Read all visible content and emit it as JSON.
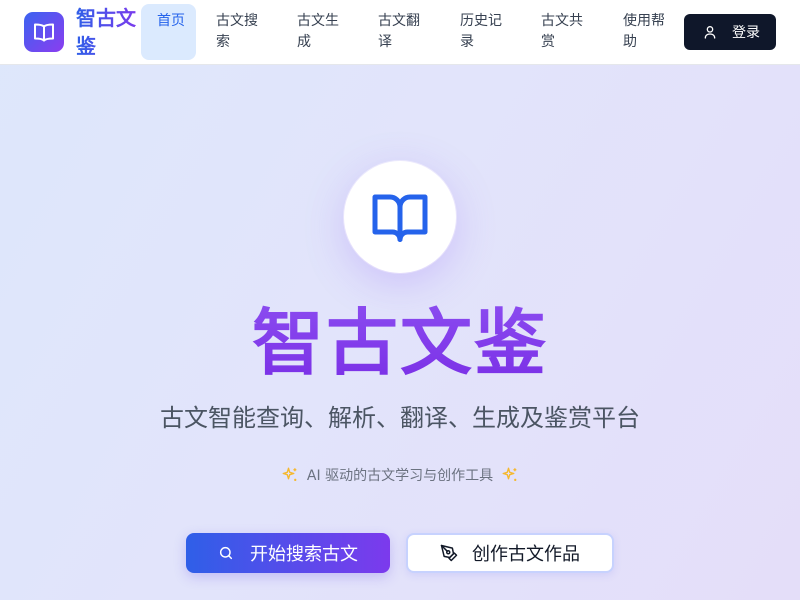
{
  "header": {
    "brand": "智古文鉴",
    "nav": [
      {
        "label": "首页",
        "active": true
      },
      {
        "label": "古文搜索",
        "active": false
      },
      {
        "label": "古文生成",
        "active": false
      },
      {
        "label": "古文翻译",
        "active": false
      },
      {
        "label": "历史记录",
        "active": false
      },
      {
        "label": "古文共赏",
        "active": false
      },
      {
        "label": "使用帮助",
        "active": false
      }
    ],
    "login_label": "登录"
  },
  "hero": {
    "title": "智古文鉴",
    "subtitle": "古文智能查询、解析、翻译、生成及鉴赏平台",
    "tagline": "AI 驱动的古文学习与创作工具",
    "primary_button": "开始搜索古文",
    "secondary_button": "创作古文作品"
  },
  "colors": {
    "accent_blue": "#2f5fe8",
    "accent_purple": "#7c3aed",
    "nav_active_bg": "#dbeafe",
    "login_bg": "#0f172a",
    "sparkle": "#f5b82e"
  }
}
